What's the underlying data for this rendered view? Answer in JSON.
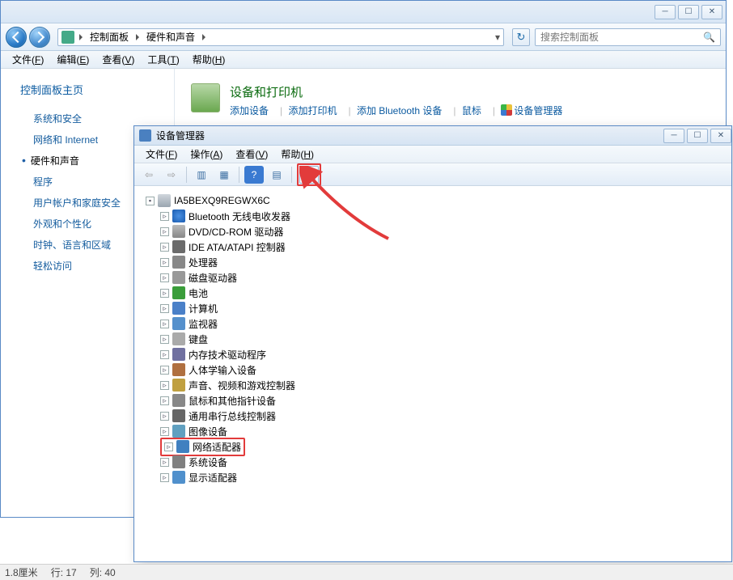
{
  "cp": {
    "breadcrumb": [
      "控制面板",
      "硬件和声音"
    ],
    "search_placeholder": "搜索控制面板",
    "menus": [
      {
        "l": "文件",
        "k": "F"
      },
      {
        "l": "编辑",
        "k": "E"
      },
      {
        "l": "查看",
        "k": "V"
      },
      {
        "l": "工具",
        "k": "T"
      },
      {
        "l": "帮助",
        "k": "H"
      }
    ],
    "side_home": "控制面板主页",
    "side_items": [
      "系统和安全",
      "网络和 Internet",
      "硬件和声音",
      "程序",
      "用户帐户和家庭安全",
      "外观和个性化",
      "时钟、语言和区域",
      "轻松访问"
    ],
    "side_active": 2,
    "cat": {
      "title": "设备和打印机",
      "links": [
        "添加设备",
        "添加打印机",
        "添加 Bluetooth 设备",
        "鼠标"
      ],
      "mgr": "设备管理器"
    }
  },
  "dm": {
    "title": "设备管理器",
    "menus": [
      {
        "l": "文件",
        "k": "F"
      },
      {
        "l": "操作",
        "k": "A"
      },
      {
        "l": "查看",
        "k": "V"
      },
      {
        "l": "帮助",
        "k": "H"
      }
    ],
    "root": "IA5BEXQ9REGWX6C",
    "items": [
      {
        "label": "Bluetooth 无线电收发器",
        "ic": "ic-bt"
      },
      {
        "label": "DVD/CD-ROM 驱动器",
        "ic": "ic-dvd"
      },
      {
        "label": "IDE ATA/ATAPI 控制器",
        "ic": "ic-ide"
      },
      {
        "label": "处理器",
        "ic": "ic-cpu"
      },
      {
        "label": "磁盘驱动器",
        "ic": "ic-disk"
      },
      {
        "label": "电池",
        "ic": "ic-bat"
      },
      {
        "label": "计算机",
        "ic": "ic-comp"
      },
      {
        "label": "监视器",
        "ic": "ic-mon"
      },
      {
        "label": "键盘",
        "ic": "ic-kb"
      },
      {
        "label": "内存技术驱动程序",
        "ic": "ic-mem"
      },
      {
        "label": "人体学输入设备",
        "ic": "ic-hid"
      },
      {
        "label": "声音、视频和游戏控制器",
        "ic": "ic-snd"
      },
      {
        "label": "鼠标和其他指针设备",
        "ic": "ic-mouse"
      },
      {
        "label": "通用串行总线控制器",
        "ic": "ic-usb"
      },
      {
        "label": "图像设备",
        "ic": "ic-img"
      },
      {
        "label": "网络适配器",
        "ic": "ic-net",
        "hl": true
      },
      {
        "label": "系统设备",
        "ic": "ic-sys"
      },
      {
        "label": "显示适配器",
        "ic": "ic-disp"
      }
    ]
  },
  "status": {
    "cm": "1.8厘米",
    "line": "行: 17",
    "col": "列: 40"
  }
}
